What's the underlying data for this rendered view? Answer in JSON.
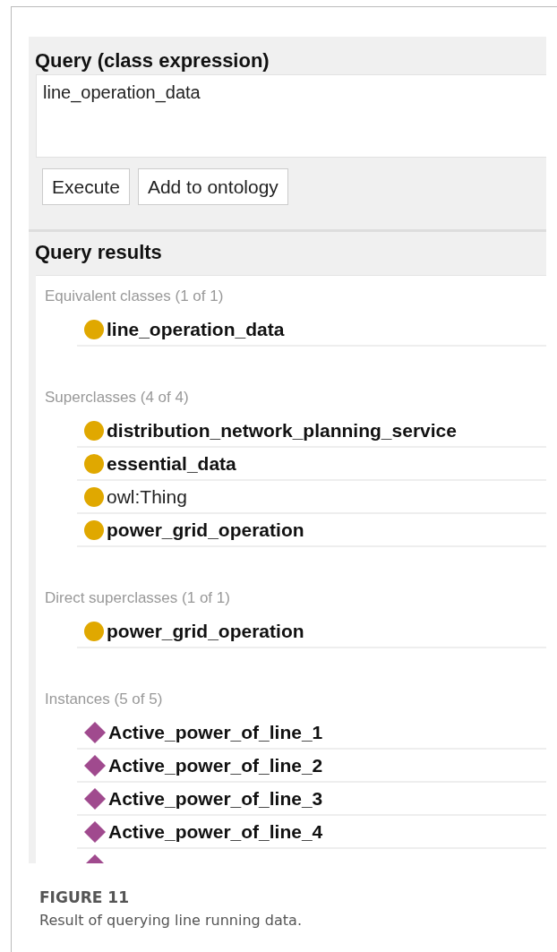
{
  "query": {
    "title": "Query (class expression)",
    "value": "line_operation_data",
    "buttons": [
      "Execute",
      "Add to ontology"
    ]
  },
  "results": {
    "title": "Query results",
    "sections": [
      {
        "title": "Equivalent classes (1 of 1)",
        "items": [
          {
            "kind": "class",
            "label": "line_operation_data",
            "bold": true
          }
        ]
      },
      {
        "title": "Superclasses (4 of 4)",
        "items": [
          {
            "kind": "class",
            "label": "distribution_network_planning_service",
            "bold": true
          },
          {
            "kind": "class",
            "label": "essential_data",
            "bold": true
          },
          {
            "kind": "class",
            "label": "owl:Thing",
            "bold": false
          },
          {
            "kind": "class",
            "label": "power_grid_operation",
            "bold": true
          }
        ]
      },
      {
        "title": "Direct superclasses (1 of 1)",
        "items": [
          {
            "kind": "class",
            "label": "power_grid_operation",
            "bold": true
          }
        ]
      },
      {
        "title": "Instances (5 of 5)",
        "items": [
          {
            "kind": "individual",
            "label": "Active_power_of_line_1",
            "bold": true
          },
          {
            "kind": "individual",
            "label": "Active_power_of_line_2",
            "bold": true
          },
          {
            "kind": "individual",
            "label": "Active_power_of_line_3",
            "bold": true
          },
          {
            "kind": "individual",
            "label": "Active_power_of_line_4",
            "bold": true
          },
          {
            "kind": "individual"
          }
        ]
      }
    ]
  },
  "caption": {
    "label": "FIGURE 11",
    "text": "Result of querying line running data."
  }
}
